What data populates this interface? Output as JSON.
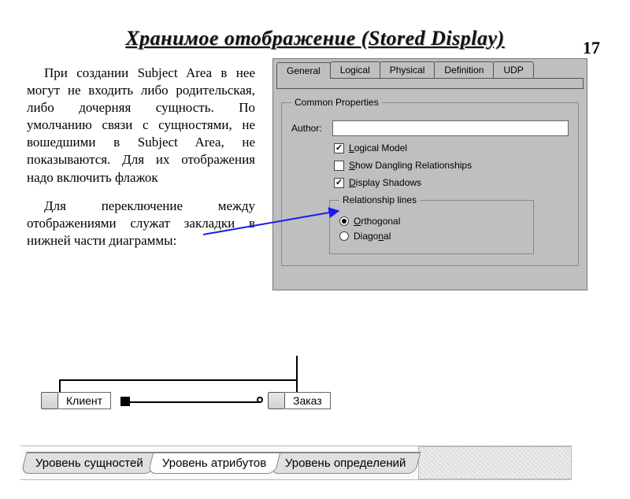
{
  "page_number": "17",
  "title": "Хранимое отображение (Stored Display)",
  "para1": "При создании Subject Area в нее могут не входить либо родительская, либо дочерняя сущность. По умолчанию связи с сущностями, не вошедшими в Subject Area, не показываются. Для их отображения надо включить флажок",
  "para2": "Для переключение между отображениями служат закладки в нижней части диаграммы:",
  "dialog": {
    "tabs": [
      "General",
      "Logical",
      "Physical",
      "Definition",
      "UDP"
    ],
    "active_tab_index": 0,
    "group_label": "Common Properties",
    "author_label": "Author:",
    "author_value": "",
    "checkboxes": [
      {
        "label_pre": "",
        "label_u": "L",
        "label_post": "ogical Model",
        "checked": true
      },
      {
        "label_pre": "",
        "label_u": "S",
        "label_post": "how Dangling Relationships",
        "checked": false
      },
      {
        "label_pre": "",
        "label_u": "D",
        "label_post": "isplay Shadows",
        "checked": true
      }
    ],
    "rel_group_label": "Relationship lines",
    "radios": [
      {
        "label_pre": "",
        "label_u": "O",
        "label_post": "rthogonal",
        "selected": true
      },
      {
        "label_pre": "Diago",
        "label_u": "n",
        "label_post": "al",
        "selected": false
      }
    ]
  },
  "er": {
    "left_entity": "Клиент",
    "right_entity": "Заказ"
  },
  "bottom_tabs": {
    "items": [
      "Уровень сущностей",
      "Уровень атрибутов",
      "Уровень определений"
    ],
    "front_index": 1
  },
  "colors": {
    "arrow": "#1a1af0"
  }
}
